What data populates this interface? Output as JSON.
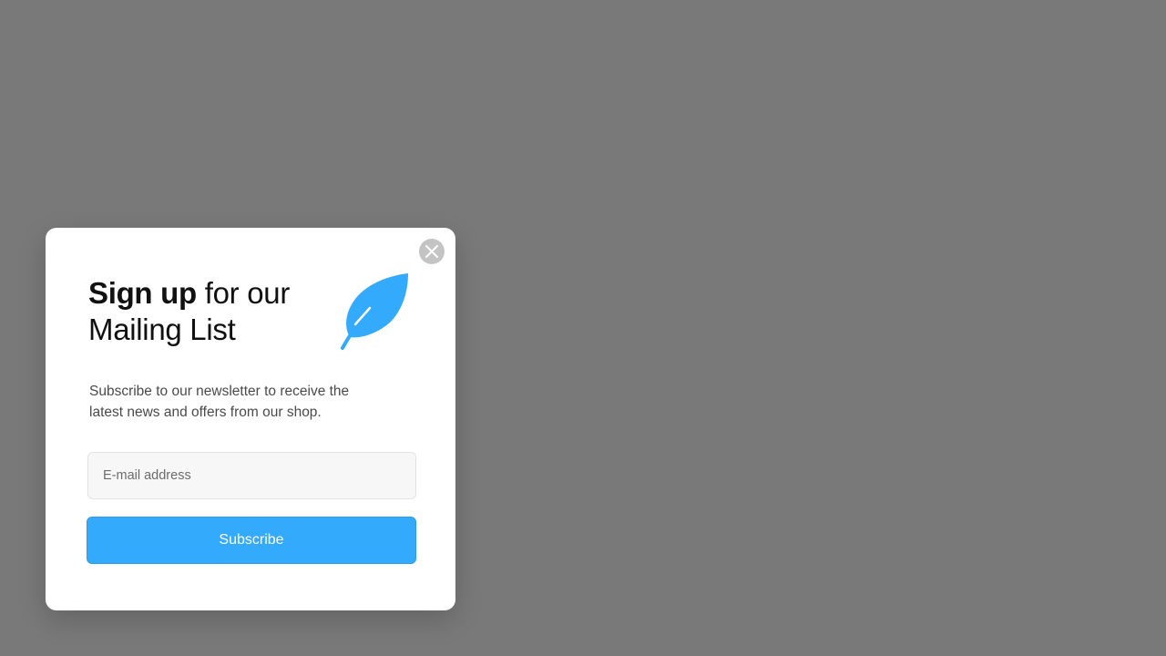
{
  "popup": {
    "headline_strong": "Sign up",
    "headline_rest": " for our",
    "headline_line2": "Mailing List",
    "description": "Subscribe to our newsletter to receive the latest news and offers from our shop.",
    "email_placeholder": "E-mail address",
    "subscribe_label": "Subscribe",
    "close_icon": "close-icon",
    "feather_icon": "feather-icon"
  },
  "colors": {
    "overlay": "#797979",
    "accent": "#34aafc",
    "close_bg": "#c4c4c4"
  }
}
